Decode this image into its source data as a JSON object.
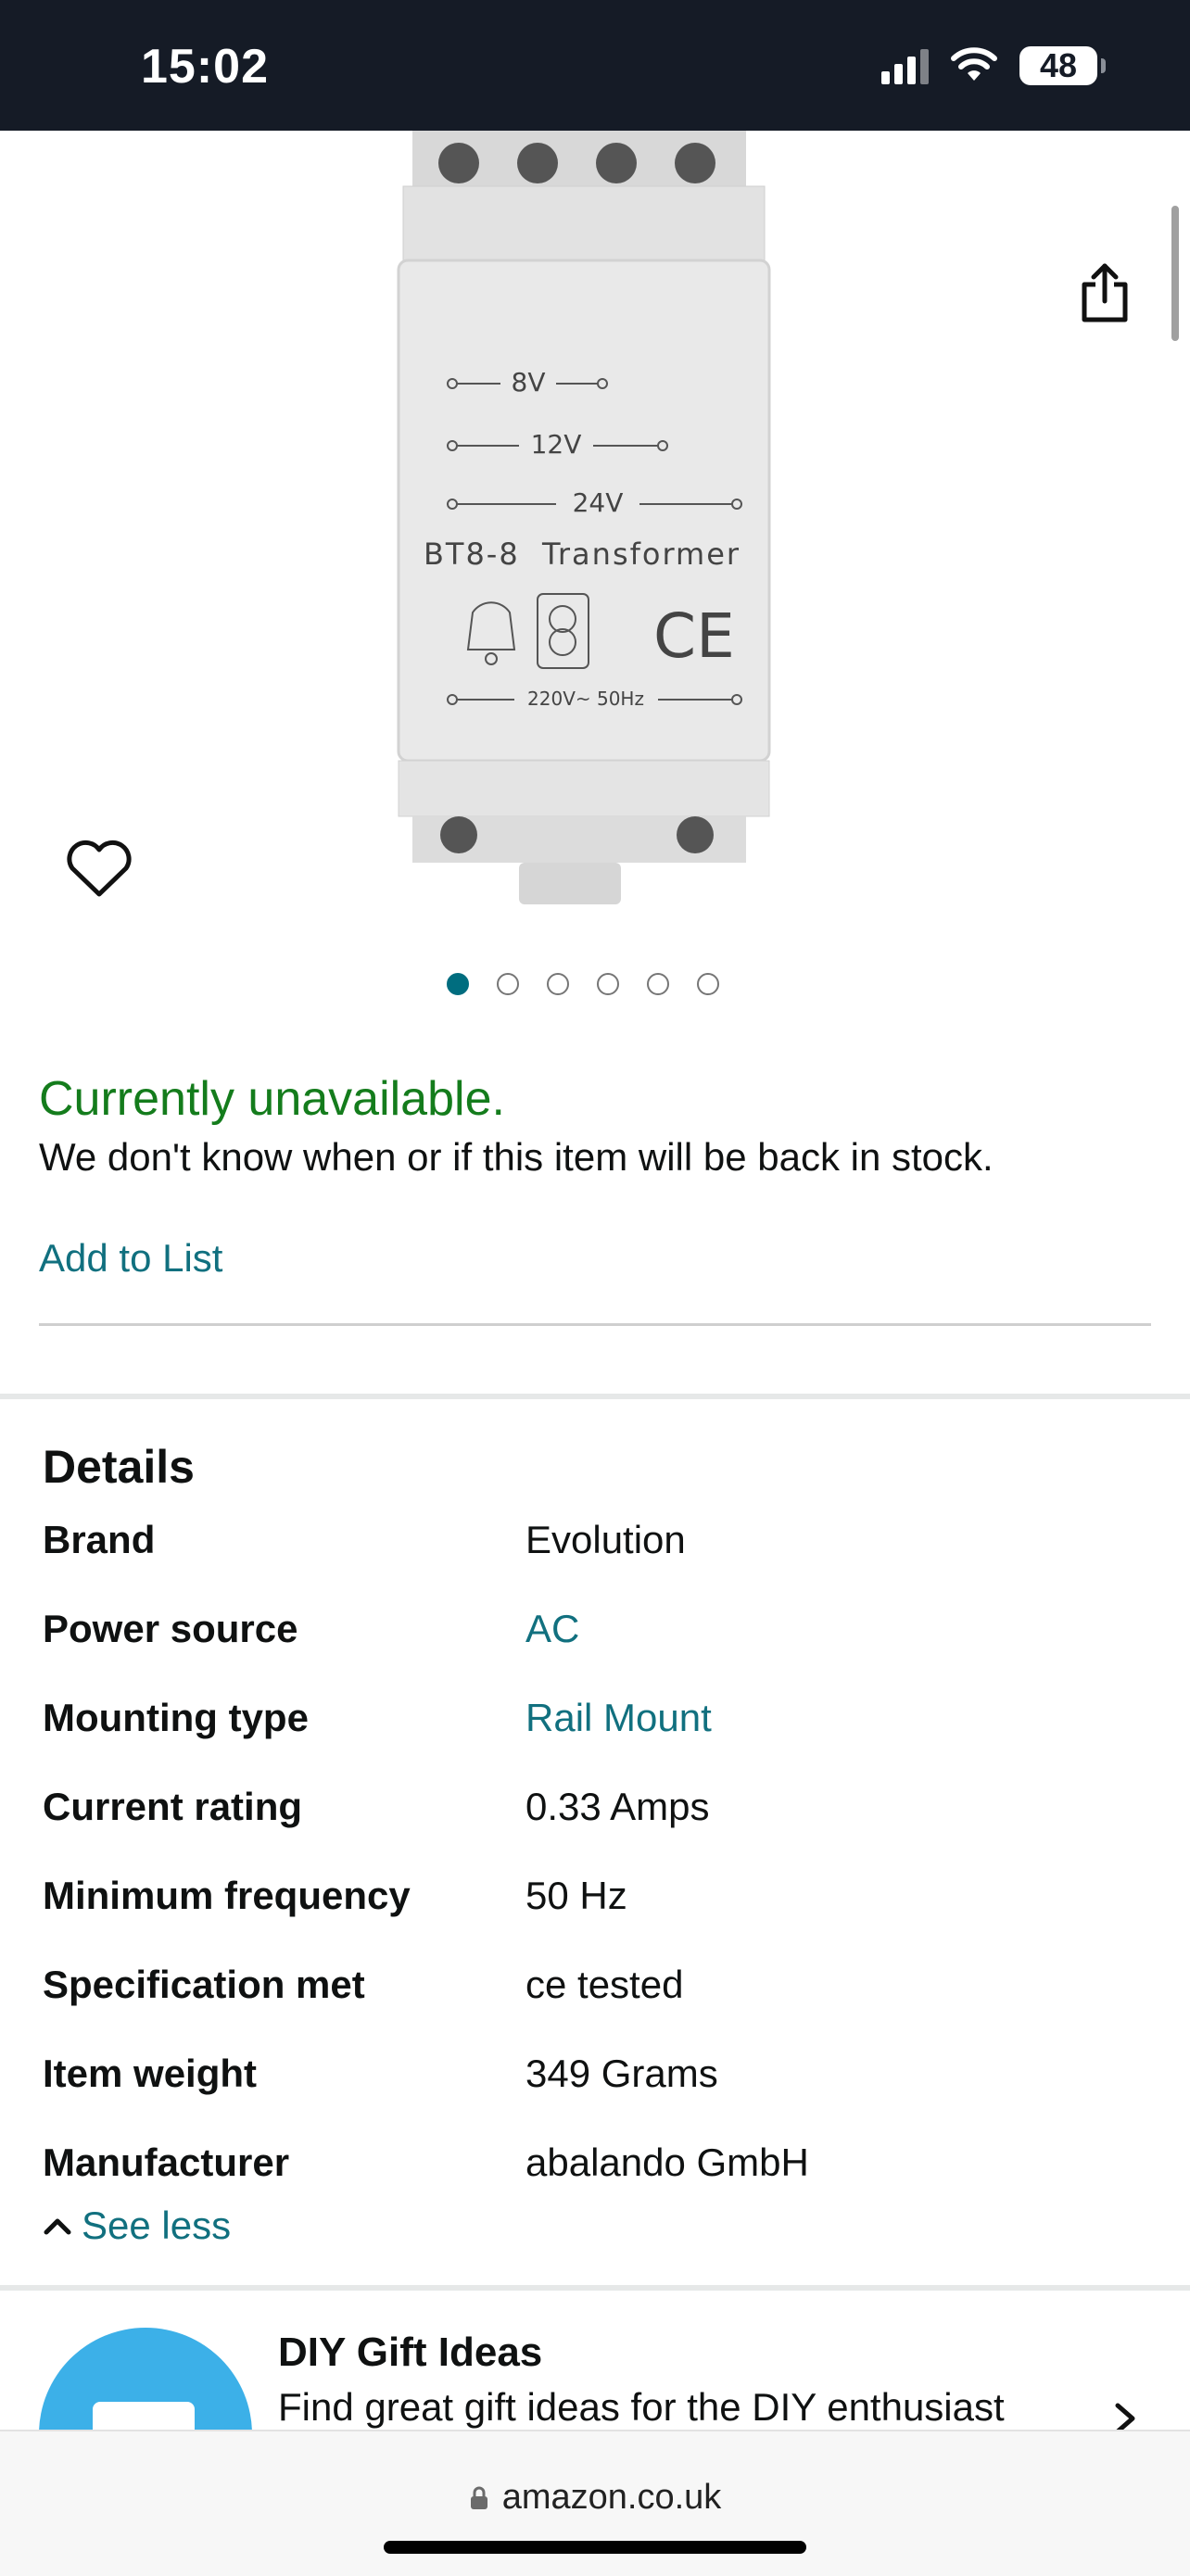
{
  "status_bar": {
    "time": "15:02",
    "battery": "48"
  },
  "product": {
    "image_labels": {
      "v8": "8V",
      "v12": "12V",
      "v24": "24V",
      "model": "BT8-8  Transformer",
      "ce": "CE",
      "input": "220V~ 50Hz"
    },
    "carousel": {
      "count": 6,
      "active_index": 0
    }
  },
  "availability": {
    "status": "Currently unavailable.",
    "note": "We don't know when or if this item will be back in stock."
  },
  "actions": {
    "add_to_list": "Add to List"
  },
  "details": {
    "title": "Details",
    "rows": [
      {
        "label": "Brand",
        "value": "Evolution",
        "link": false
      },
      {
        "label": "Power source",
        "value": "AC",
        "link": true
      },
      {
        "label": "Mounting type",
        "value": "Rail Mount",
        "link": true
      },
      {
        "label": "Current rating",
        "value": "0.33 Amps",
        "link": false
      },
      {
        "label": "Minimum frequency",
        "value": "50 Hz",
        "link": false
      },
      {
        "label": "Specification met",
        "value": "ce tested",
        "link": false
      },
      {
        "label": "Item weight",
        "value": "349 Grams",
        "link": false
      },
      {
        "label": "Manufacturer",
        "value": "abalando GmbH",
        "link": false
      }
    ],
    "see_less": "See less"
  },
  "promo": {
    "title": "DIY Gift Ideas",
    "description": "Find great gift ideas for the DIY enthusiast"
  },
  "browser": {
    "url": "amazon.co.uk"
  },
  "colors": {
    "link": "#11707f",
    "available_green": "#147c1c",
    "status_bar_bg": "#151b26",
    "dot_active": "#006d7f"
  }
}
